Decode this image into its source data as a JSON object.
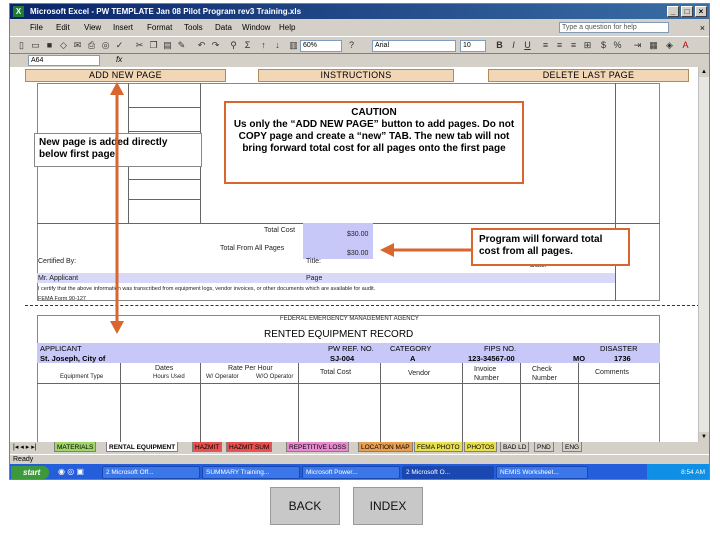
{
  "window": {
    "title": "Microsoft Excel - PW TEMPLATE Jan 08 Pilot Program rev3 Training.xls",
    "icon": "excel-icon"
  },
  "menu": {
    "items": [
      "File",
      "Edit",
      "View",
      "Insert",
      "Format",
      "Tools",
      "Data",
      "Window",
      "Help"
    ],
    "help_placeholder": "Type a question for help"
  },
  "toolbar": {
    "zoom": "60%",
    "font_name": "Arial",
    "font_size": "10"
  },
  "formula_bar": {
    "name_box": "A64",
    "fx": "fx"
  },
  "sheet_buttons": {
    "add": "ADD NEW PAGE",
    "instructions": "INSTRUCTIONS",
    "delete": "DELETE LAST PAGE"
  },
  "form_upper": {
    "total_cost_label": "Total Cost",
    "total_cost_value": "$30.00",
    "total_all_pages_label": "Total From All Pages",
    "total_all_pages_value": "$30.00",
    "certified_by": "Certified By:",
    "title_label": "Title:",
    "date_label": "Date:",
    "applicant_label": "Mr. Applicant",
    "page_label": "Page",
    "certify_text": "I certify that the above information was transcribed from equipment logs, vendor invoices, or other documents which are available for audit.",
    "form_number": "FEMA Form 90-127"
  },
  "form_lower": {
    "agency": "FEDERAL EMERGENCY MANAGEMENT AGENCY",
    "record_title": "RENTED EQUIPMENT RECORD",
    "headers": [
      "APPLICANT",
      "PW REF. NO.",
      "CATEGORY",
      "FIPS NO.",
      "DISASTER"
    ],
    "values": [
      "St. Joseph, City of",
      "SJ-004",
      "A",
      "123-34567-00",
      "MO",
      "1736"
    ],
    "col_headers": [
      "Equipment Type",
      "Rate Per Hour",
      "Total Cost",
      "Vendor",
      "Invoice Number",
      "Check Number",
      "Comments"
    ],
    "sub_headers": [
      "Dates",
      "Hours Used",
      "W/ Operator",
      "W/O Operator"
    ]
  },
  "callouts": {
    "new_page": "New page is added directly below first page.",
    "caution_title": "CAUTION",
    "caution_body": "Us only the “ADD NEW PAGE” button to add pages. Do not COPY page and create a “new” TAB.  The new tab will not bring forward total cost for all pages onto the first page",
    "forward": "Program will forward total cost from all pages."
  },
  "tabs": [
    "MATERIALS",
    "RENTAL EQUIPMENT",
    "HAZMIT",
    "HAZMIT SUM",
    "REPETITIVE LOSS",
    "LOCATION MAP",
    "FEMA PHOTO",
    "PHOTOS",
    "BAD LD",
    "PND",
    "ENG"
  ],
  "status": "Ready",
  "taskbar": {
    "start": "start",
    "tasks": [
      "2 Microsoft Off...",
      "SUMMARY Training...",
      "Microsoft Power...",
      "2 Microsoft O...",
      "NEMIS Worksheet..."
    ],
    "clock": "8:54 AM"
  },
  "nav": {
    "back": "BACK",
    "index": "INDEX"
  },
  "colors": {
    "callout_border": "#d9662e",
    "button_bg": "#f2d7b6",
    "header_purple": "#c8c8f8"
  }
}
